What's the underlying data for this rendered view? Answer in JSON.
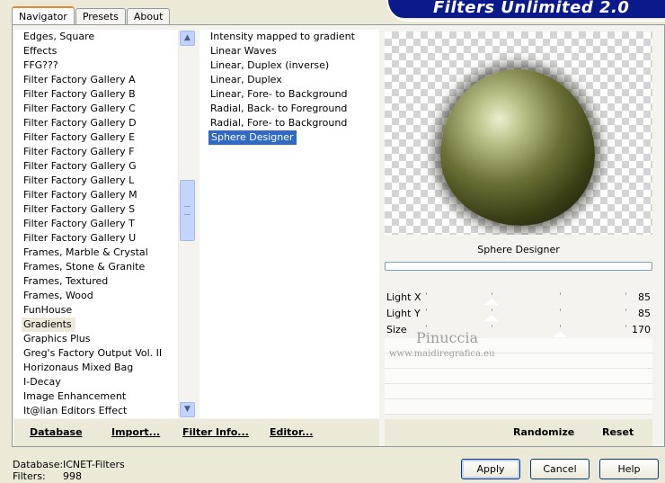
{
  "tabs": [
    {
      "label": "Navigator"
    },
    {
      "label": "Presets"
    },
    {
      "label": "About"
    }
  ],
  "banner": {
    "title": "Filters Unlimited 2.0"
  },
  "categories": [
    {
      "label": "Edges, Square"
    },
    {
      "label": "Effects"
    },
    {
      "label": "FFG???"
    },
    {
      "label": "Filter Factory Gallery A"
    },
    {
      "label": "Filter Factory Gallery B"
    },
    {
      "label": "Filter Factory Gallery C"
    },
    {
      "label": "Filter Factory Gallery D"
    },
    {
      "label": "Filter Factory Gallery E"
    },
    {
      "label": "Filter Factory Gallery F"
    },
    {
      "label": "Filter Factory Gallery G"
    },
    {
      "label": "Filter Factory Gallery L"
    },
    {
      "label": "Filter Factory Gallery M"
    },
    {
      "label": "Filter Factory Gallery S"
    },
    {
      "label": "Filter Factory Gallery T"
    },
    {
      "label": "Filter Factory Gallery U"
    },
    {
      "label": "Frames, Marble & Crystal"
    },
    {
      "label": "Frames, Stone & Granite"
    },
    {
      "label": "Frames, Textured"
    },
    {
      "label": "Frames, Wood"
    },
    {
      "label": "FunHouse"
    },
    {
      "label": "Gradients"
    },
    {
      "label": "Graphics Plus"
    },
    {
      "label": "Greg's Factory Output Vol. II"
    },
    {
      "label": "Horizonaus Mixed Bag"
    },
    {
      "label": "I-Decay"
    },
    {
      "label": "Image Enhancement"
    },
    {
      "label": "It@lian Editors Effect"
    }
  ],
  "selected_category": "Gradients",
  "filters": [
    {
      "label": "Intensity mapped to gradient"
    },
    {
      "label": "Linear Waves"
    },
    {
      "label": "Linear, Duplex (inverse)"
    },
    {
      "label": "Linear, Duplex"
    },
    {
      "label": "Linear, Fore- to Background"
    },
    {
      "label": "Radial, Back- to Foreground"
    },
    {
      "label": "Radial, Fore- to Background"
    },
    {
      "label": "Sphere Designer"
    }
  ],
  "selected_filter": "Sphere Designer",
  "preview": {
    "filter_name": "Sphere Designer"
  },
  "params": [
    {
      "label": "Light X",
      "value": "85",
      "level": 0.33
    },
    {
      "label": "Light Y",
      "value": "85",
      "level": 0.33
    },
    {
      "label": "Size",
      "value": "170",
      "level": 0.67
    }
  ],
  "watermark": {
    "name": "Pinuccia",
    "url": "www.maidiregrafica.eu"
  },
  "toolbar": {
    "database": "Database",
    "import": "Import...",
    "filter_info": "Filter Info...",
    "editor": "Editor...",
    "randomize": "Randomize",
    "reset": "Reset"
  },
  "info": {
    "database_label": "Database:",
    "database_value": "ICNET-Filters",
    "filters_label": "Filters:",
    "filters_value": "998"
  },
  "buttons": {
    "apply": "Apply",
    "cancel": "Cancel",
    "help": "Help"
  },
  "colors": {
    "banner": "#0a1a8a",
    "selection": "#316ac5",
    "tab_accent": "#e68b2c"
  }
}
